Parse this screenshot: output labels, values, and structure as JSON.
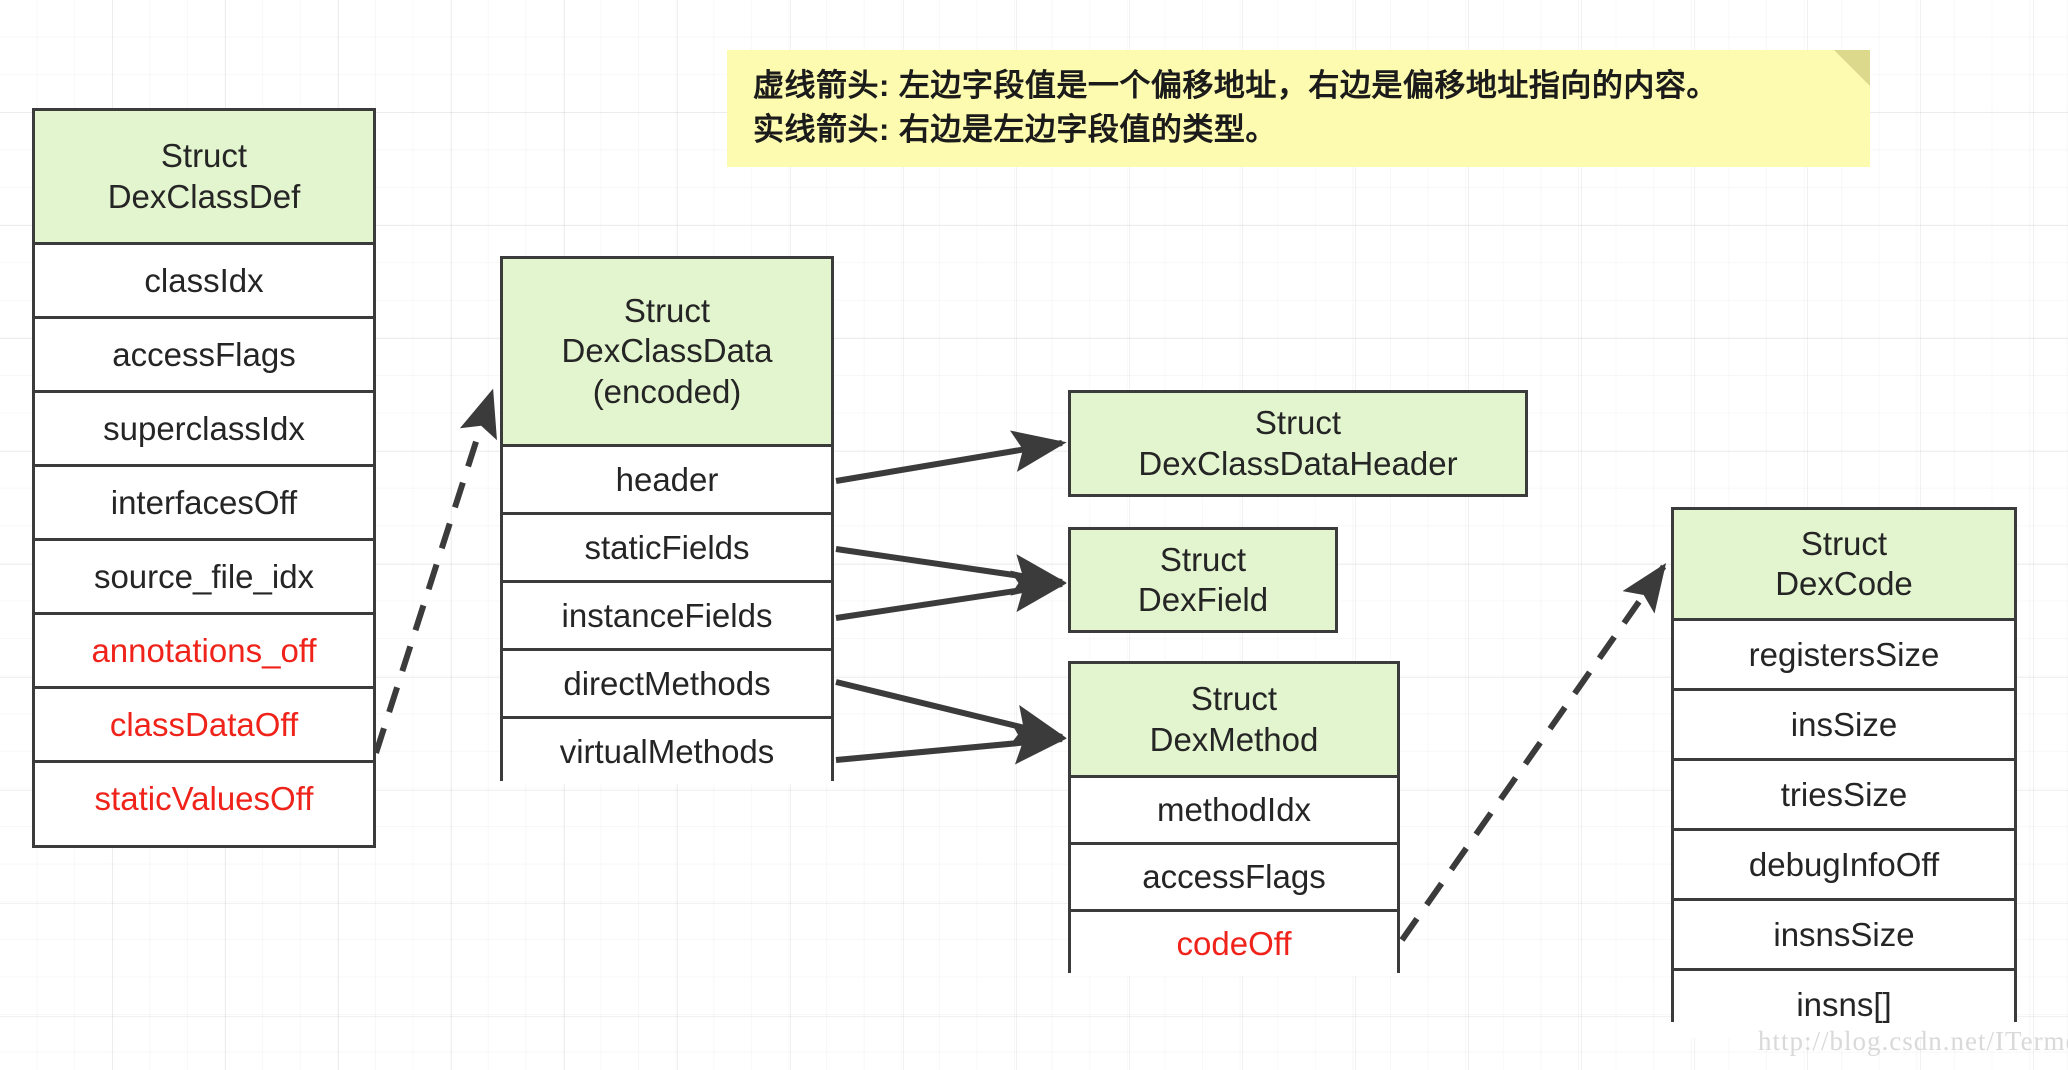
{
  "note": {
    "lines": [
      "虚线箭头: 左边字段值是一个偏移地址，右边是偏移地址指向的内容。",
      "实线箭头: 右边是左边字段值的类型。"
    ]
  },
  "colors": {
    "header_fill": "#e3f5ce",
    "border": "#3b3b3b",
    "red_field": "#f0231b",
    "note_fill": "#fdfbb0",
    "note_fold": "#ddd98c",
    "grid": "#ededed"
  },
  "structs": {
    "dexclassdef": {
      "title_lines": [
        "Struct",
        "DexClassDef"
      ],
      "fields": [
        {
          "label": "classIdx",
          "red": false
        },
        {
          "label": "accessFlags",
          "red": false
        },
        {
          "label": "superclassIdx",
          "red": false
        },
        {
          "label": "interfacesOff",
          "red": false
        },
        {
          "label": "source_file_idx",
          "red": false
        },
        {
          "label": "annotations_off",
          "red": true
        },
        {
          "label": "classDataOff",
          "red": true
        },
        {
          "label": "staticValuesOff",
          "red": true
        }
      ]
    },
    "dexclassdata": {
      "title_lines": [
        "Struct",
        "DexClassData",
        "(encoded)"
      ],
      "fields": [
        {
          "label": "header",
          "red": false
        },
        {
          "label": "staticFields",
          "red": false
        },
        {
          "label": "instanceFields",
          "red": false
        },
        {
          "label": "directMethods",
          "red": false
        },
        {
          "label": "virtualMethods",
          "red": false
        }
      ]
    },
    "dexclassdataheader": {
      "title_lines": [
        "Struct",
        "DexClassDataHeader"
      ],
      "fields": []
    },
    "dexfield": {
      "title_lines": [
        "Struct",
        "DexField"
      ],
      "fields": []
    },
    "dexmethod": {
      "title_lines": [
        "Struct",
        "DexMethod"
      ],
      "fields": [
        {
          "label": "methodIdx",
          "red": false
        },
        {
          "label": "accessFlags",
          "red": false
        },
        {
          "label": "codeOff",
          "red": true
        }
      ]
    },
    "dexcode": {
      "title_lines": [
        "Struct",
        "DexCode"
      ],
      "fields": [
        {
          "label": "registersSize",
          "red": false
        },
        {
          "label": "insSize",
          "red": false
        },
        {
          "label": "triesSize",
          "red": false
        },
        {
          "label": "debugInfoOff",
          "red": false
        },
        {
          "label": "insnsSize",
          "red": false
        },
        {
          "label": "insns[]",
          "red": false
        }
      ]
    }
  },
  "connections": [
    {
      "from": "dexclassdef.classDataOff",
      "to": "dexclassdata",
      "style": "dashed"
    },
    {
      "from": "dexclassdata.header",
      "to": "dexclassdataheader",
      "style": "solid"
    },
    {
      "from": "dexclassdata.staticFields",
      "to": "dexfield",
      "style": "solid"
    },
    {
      "from": "dexclassdata.instanceFields",
      "to": "dexfield",
      "style": "solid"
    },
    {
      "from": "dexclassdata.directMethods",
      "to": "dexmethod",
      "style": "solid"
    },
    {
      "from": "dexclassdata.virtualMethods",
      "to": "dexmethod",
      "style": "solid"
    },
    {
      "from": "dexmethod.codeOff",
      "to": "dexcode",
      "style": "dashed"
    }
  ],
  "watermark": {
    "text": "http://blog.csdn.net/ITermeng"
  }
}
